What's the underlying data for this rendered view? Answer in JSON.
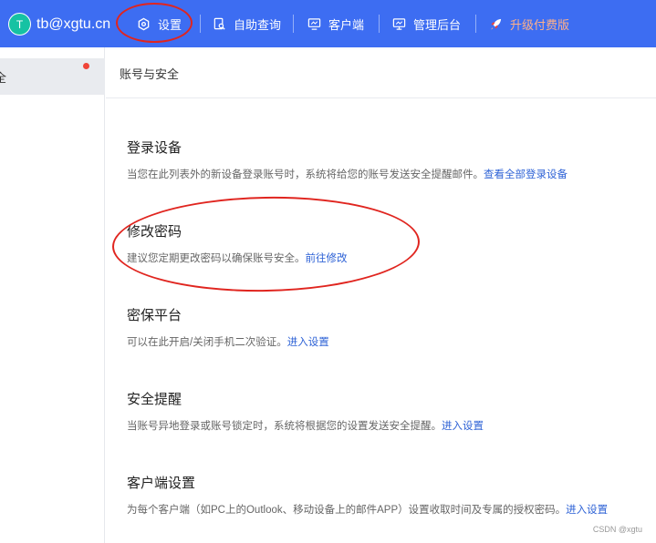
{
  "topbar": {
    "avatar_letter": "T",
    "email": "tb@xgtu.cn",
    "nav": [
      {
        "label": "设置",
        "icon": "gear-icon"
      },
      {
        "label": "自助查询",
        "icon": "search-document-icon"
      },
      {
        "label": "客户端",
        "icon": "monitor-icon"
      },
      {
        "label": "管理后台",
        "icon": "monitor-icon"
      },
      {
        "label": "升级付费版",
        "icon": "rocket-icon"
      }
    ],
    "colors": {
      "background": "#3d6df2",
      "upgrade_text": "#ffb089"
    }
  },
  "sidebar": {
    "items": [
      {
        "label": "全"
      }
    ]
  },
  "main": {
    "page_title": "账号与安全",
    "sections": [
      {
        "title": "登录设备",
        "desc": "当您在此列表外的新设备登录账号时，系统将给您的账号发送安全提醒邮件。",
        "link": "查看全部登录设备"
      },
      {
        "title": "修改密码",
        "desc": "建议您定期更改密码以确保账号安全。",
        "link": "前往修改"
      },
      {
        "title": "密保平台",
        "desc": "可以在此开启/关闭手机二次验证。",
        "link": "进入设置"
      },
      {
        "title": "安全提醒",
        "desc": "当账号异地登录或账号锁定时，系统将根据您的设置发送安全提醒。",
        "link": "进入设置"
      },
      {
        "title": "客户端设置",
        "desc": "为每个客户端（如PC上的Outlook、移动设备上的邮件APP）设置收取时间及专属的授权密码。",
        "link": "进入设置"
      }
    ]
  },
  "watermark": "CSDN @xgtu"
}
